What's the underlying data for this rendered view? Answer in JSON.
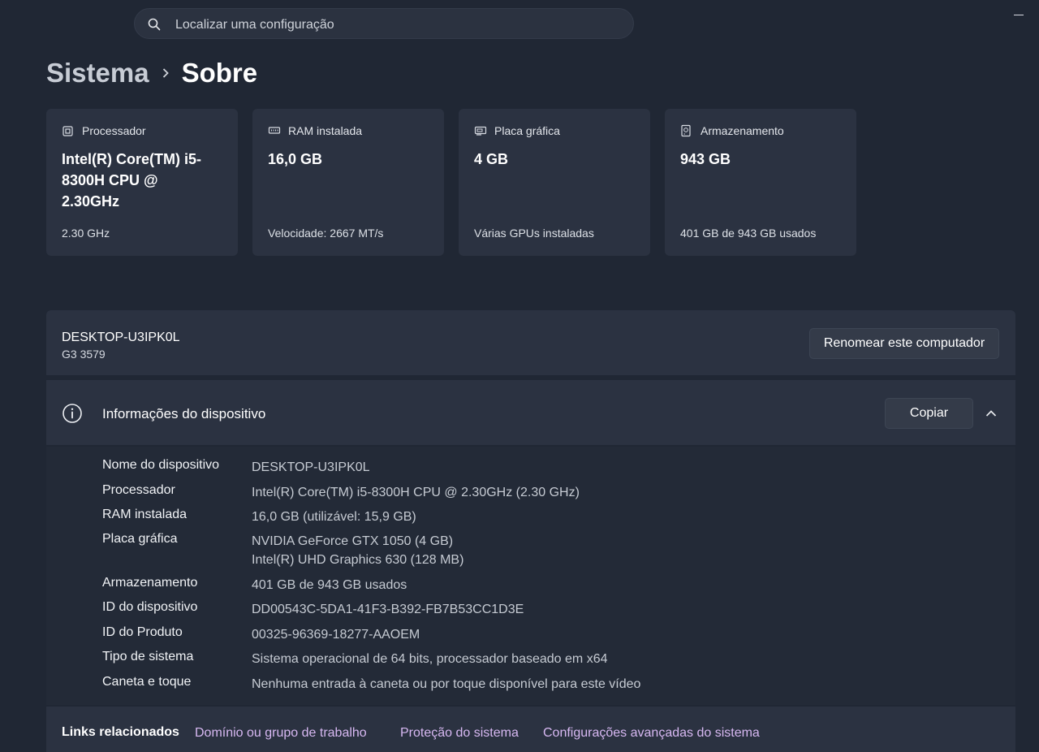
{
  "search": {
    "placeholder": "Localizar uma configuração"
  },
  "breadcrumb": {
    "parent": "Sistema",
    "current": "Sobre"
  },
  "specs": [
    {
      "icon": "processor-icon",
      "title": "Processador",
      "value": "Intel(R) Core(TM) i5-8300H CPU @ 2.30GHz",
      "sub": "2.30 GHz"
    },
    {
      "icon": "ram-icon",
      "title": "RAM instalada",
      "value": "16,0 GB",
      "sub": "Velocidade: 2667 MT/s"
    },
    {
      "icon": "graphics-card-icon",
      "title": "Placa gráfica",
      "value": "4 GB",
      "sub": "Várias GPUs instaladas"
    },
    {
      "icon": "storage-icon",
      "title": "Armazenamento",
      "value": "943 GB",
      "sub": "401 GB de 943 GB usados"
    }
  ],
  "computer": {
    "name": "DESKTOP-U3IPK0L",
    "model": "G3 3579",
    "rename_label": "Renomear este computador"
  },
  "device_info": {
    "title": "Informações do dispositivo",
    "copy_label": "Copiar",
    "rows": [
      {
        "label": "Nome do dispositivo",
        "value": "DESKTOP-U3IPK0L"
      },
      {
        "label": "Processador",
        "value": "Intel(R) Core(TM) i5-8300H CPU @ 2.30GHz (2.30 GHz)"
      },
      {
        "label": "RAM instalada",
        "value": "16,0 GB (utilizável: 15,9 GB)"
      },
      {
        "label": "Placa gráfica",
        "value": "NVIDIA GeForce GTX 1050 (4 GB)",
        "value2": "Intel(R) UHD Graphics 630 (128 MB)"
      },
      {
        "label": "Armazenamento",
        "value": "401 GB de 943 GB usados"
      },
      {
        "label": "ID do dispositivo",
        "value": "DD00543C-5DA1-41F3-B392-FB7B53CC1D3E"
      },
      {
        "label": "ID do Produto",
        "value": "00325-96369-18277-AAOEM"
      },
      {
        "label": "Tipo de sistema",
        "value": "Sistema operacional de 64 bits, processador baseado em x64"
      },
      {
        "label": "Caneta e toque",
        "value": "Nenhuma entrada à caneta ou por toque disponível para este vídeo"
      }
    ]
  },
  "related_links": {
    "label": "Links relacionados",
    "items": [
      "Domínio ou grupo de trabalho",
      "Proteção do sistema",
      "Configurações avançadas do sistema"
    ]
  },
  "colors": {
    "background": "#202734",
    "card": "#2b3241",
    "link": "#d7b8f2"
  }
}
